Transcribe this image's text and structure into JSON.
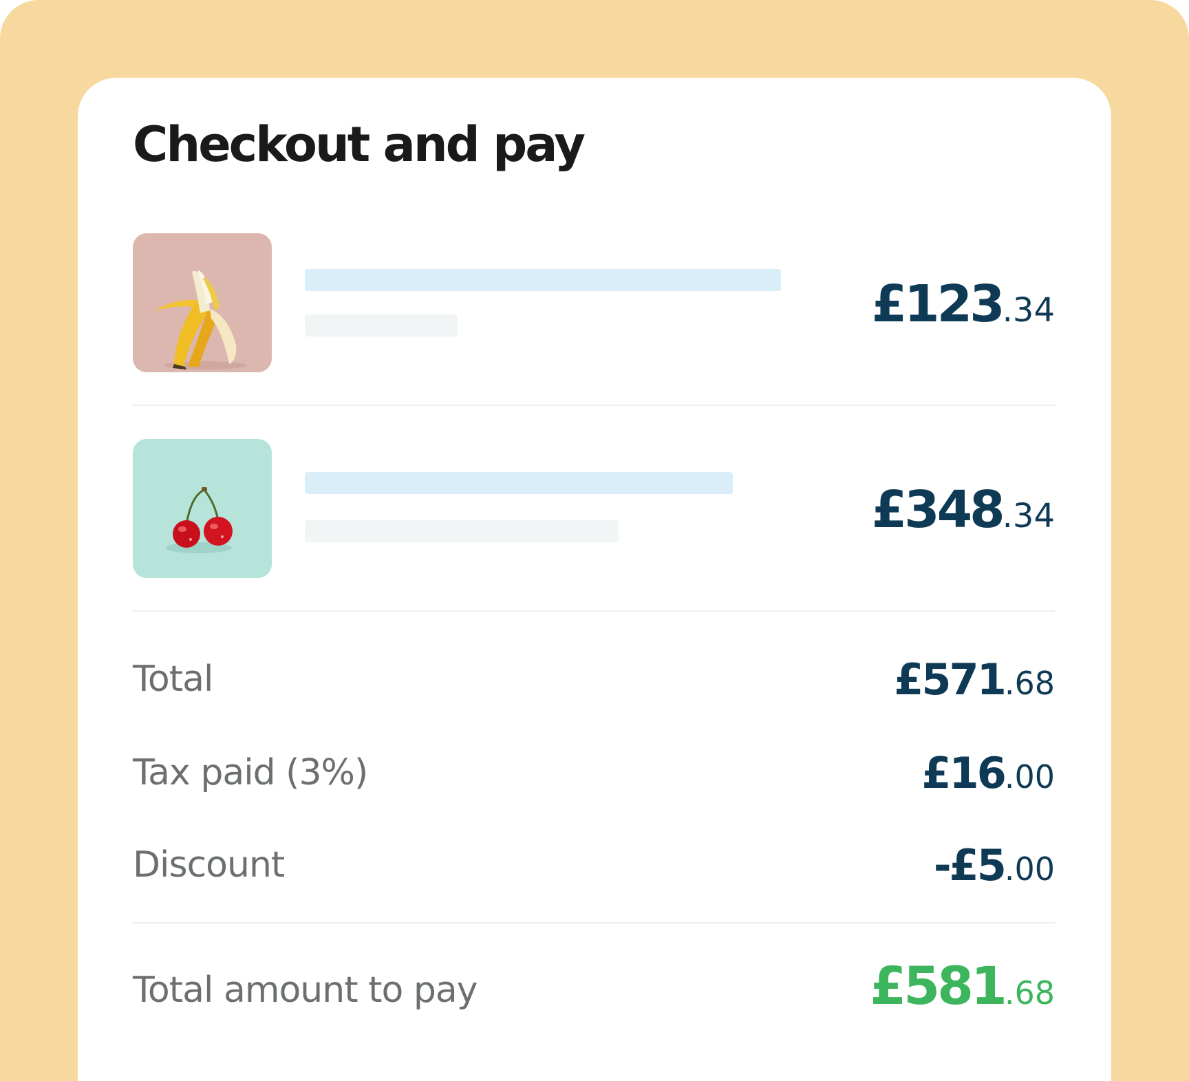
{
  "checkout": {
    "title": "Checkout  and pay",
    "items": [
      {
        "name": "banana-item",
        "price_major": "£123",
        "price_minor": ".34"
      },
      {
        "name": "cherry-item",
        "price_major": "£348",
        "price_minor": ".34"
      }
    ],
    "summary": {
      "total_label": "Total",
      "total_major": "£571",
      "total_minor": ".68",
      "tax_label": "Tax paid (3%)",
      "tax_major": "£16",
      "tax_minor": ".00",
      "discount_label": "Discount",
      "discount_major": "-£5",
      "discount_minor": ".00",
      "pay_label": "Total amount to pay",
      "pay_major": "£581",
      "pay_minor": ".68"
    }
  },
  "colors": {
    "background_frame": "#f7d9a0",
    "card": "#ffffff",
    "price_text": "#0f3a55",
    "total_pay_accent": "#3cb55c",
    "label_text": "#6c6f70",
    "skeleton_title": "#daeef9",
    "skeleton_sub": "#f1f5f5",
    "banana_thumb_bg": "#dcb7af",
    "cherry_thumb_bg": "#b6e4db"
  }
}
